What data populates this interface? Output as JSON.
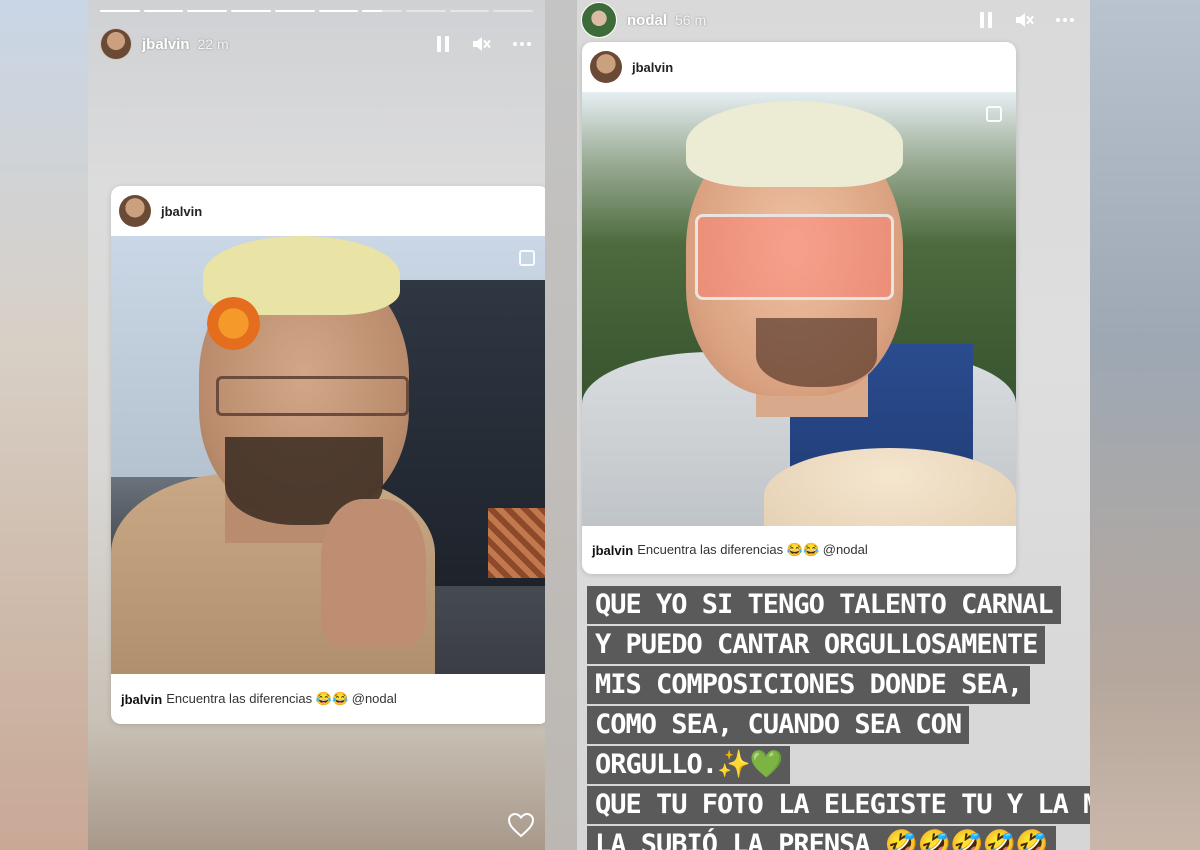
{
  "left_story": {
    "username": "jbalvin",
    "time": "22 m",
    "progress_segments": [
      1,
      1,
      1,
      1,
      1,
      1,
      0.5,
      0,
      0,
      0
    ],
    "post": {
      "username": "jbalvin",
      "caption_user": "jbalvin",
      "caption_text": "Encuentra las diferencias 😂😂 @nodal"
    }
  },
  "right_story": {
    "username": "nodal",
    "time": "56 m",
    "post": {
      "username": "jbalvin",
      "caption_user": "jbalvin",
      "caption_text": "Encuentra las diferencias 😂😂 @nodal"
    },
    "text_lines": [
      "QUE YO SI TENGO TALENTO CARNAL",
      "Y PUEDO CANTAR ORGULLOSAMENTE",
      "MIS COMPOSICIONES DONDE SEA,",
      "COMO SEA, CUANDO SEA CON",
      "ORGULLO.✨💚",
      "QUE TU FOTO LA ELEGISTE TU Y LA MÍA",
      "LA SUBIÓ LA PRENSA 🤣🤣🤣🤣🤣"
    ]
  },
  "icons": {
    "pause": "pause-icon",
    "mute": "mute-icon",
    "more": "more-icon",
    "heart": "heart-icon",
    "multi": "multi-photo-icon"
  }
}
